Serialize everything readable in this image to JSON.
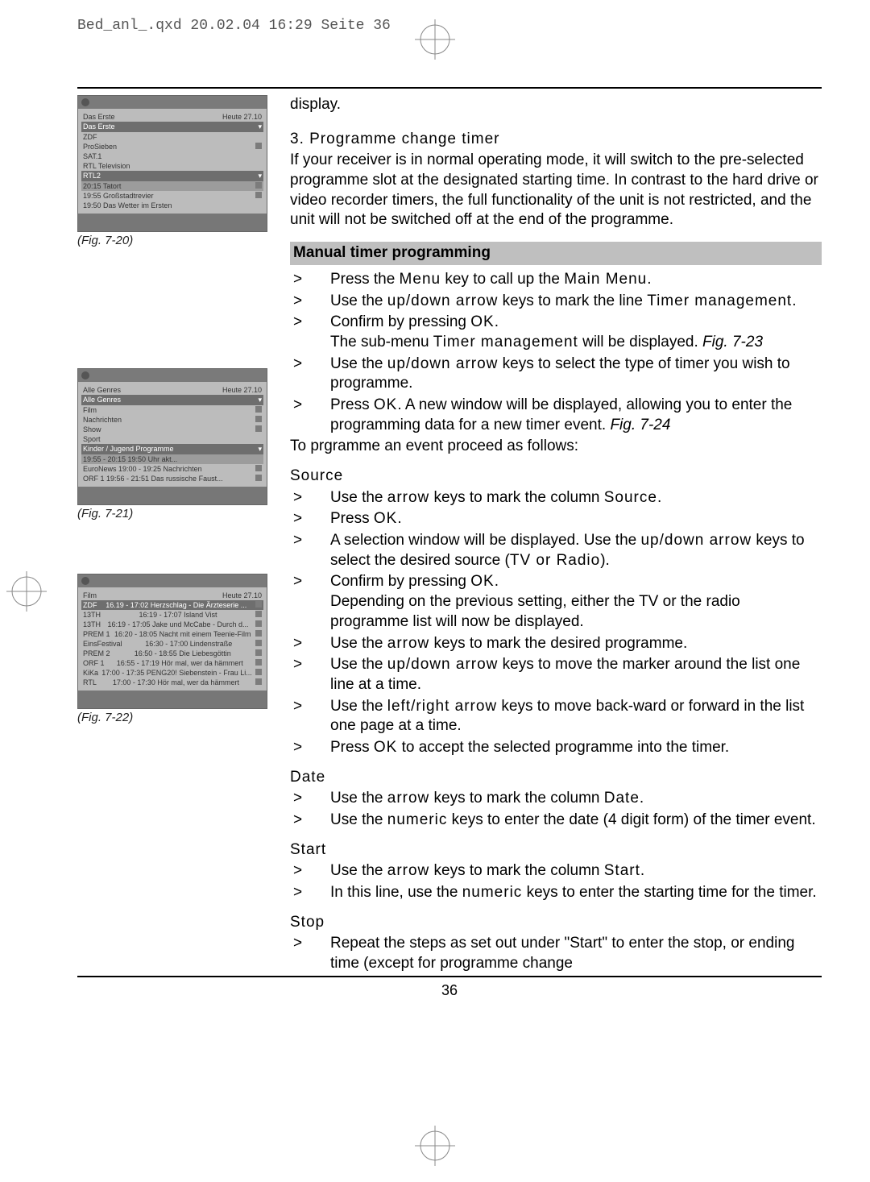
{
  "header": "Bed_anl_.qxd  20.02.04  16:29  Seite 36",
  "page_number": "36",
  "figures": {
    "f20": {
      "caption": "(Fig. 7-20)",
      "top_right": "Heute 27.10",
      "rows": [
        "Das Erste",
        "Das Erste",
        "ZDF",
        "ProSieben",
        "SAT.1",
        "RTL Television",
        "RTL2",
        "20:15 Tatort",
        "19:55 Großstadtrevier",
        "19:50 Das Wetter im Ersten"
      ]
    },
    "f21": {
      "caption": "(Fig. 7-21)",
      "top_right": "Heute 27.10",
      "rows": [
        "Alle Genres",
        "Alle Genres",
        "Film",
        "Nachrichten",
        "Show",
        "Sport",
        "Kinder / Jugend Programme",
        "19:55 - 20:15 19:50 Uhr akt...",
        "EuroNews   19:00 - 19:25 Nachrichten",
        "ORF 1   19:56 - 21:51 Das russische Faust..."
      ]
    },
    "f22": {
      "caption": "(Fig. 7-22)",
      "top_right": "Heute 27.10",
      "label": "Film",
      "rows": [
        {
          "ch": "ZDF",
          "t": "16.19 - 17:02 Herzschlag - Die Ärzteserie ..."
        },
        {
          "ch": "13TH",
          "t": "16:19 - 17:07 Island Vist"
        },
        {
          "ch": "13TH",
          "t": "16:19 - 17:05 Jake und McCabe - Durch d..."
        },
        {
          "ch": "PREM 1",
          "t": "16:20 - 18:05 Nacht mit einem Teenie-Film"
        },
        {
          "ch": "EinsFestival",
          "t": "16:30 - 17:00 Lindenstraße"
        },
        {
          "ch": "PREM 2",
          "t": "16:50 - 18:55 Die Liebesgöttin"
        },
        {
          "ch": "ORF 1",
          "t": "16:55 - 17:19 Hör mal, wer da hämmert"
        },
        {
          "ch": "KiKa",
          "t": "17:00 - 17:35 PENG20! Siebenstein - Frau Li..."
        },
        {
          "ch": "RTL",
          "t": "17:00 - 17:30 Hör mal, wer da hämmert"
        }
      ]
    }
  },
  "body": {
    "intro_cont": "display.",
    "sec3_title": "3. Programme change timer",
    "sec3_para": "If your receiver is in normal operating mode, it will switch to the pre-selected programme slot at the designated starting time. In contrast to the hard drive or video recorder timers, the full functionality of the unit is not restricted, and the unit will not be switched off at the end of the programme.",
    "manual_heading": "Manual timer programming",
    "steps_top": [
      "Press the <span class='ls'>Menu</span> key to call up the <span class='ls'>Main Menu</span>.",
      "Use the <span class='ls'>up/down arrow</span> keys to mark the line <span class='ls'>Timer management</span>.",
      "Confirm by pressing <span class='ls'>OK</span>.<br>The sub-menu <span class='ls'>Timer management</span> will be displayed. <span class='i'>Fig. 7-23</span>",
      "Use the <span class='ls'>up/down arrow</span> keys to select the type of timer you wish to programme.",
      "Press <span class='ls'>OK</span>. A new window will be displayed, allowing you to enter the programming data for a new timer event. <span class='i'>Fig. 7-24</span>"
    ],
    "to_programme": "To prgramme an event proceed as follows:",
    "source_label": "Source",
    "source_steps": [
      "Use the <span class='ls'>arrow</span> keys to mark the column <span class='ls'>Source</span>.",
      "Press <span class='ls'>OK</span>.",
      "A selection window will be displayed. Use the <span class='ls'>up/down arrow</span> keys to select the desired source (<span class='ls'>TV or Radio</span>).",
      "Confirm by pressing <span class='ls'>OK</span>.<br>Depending on the previous setting, either the TV or the radio programme list will now be displayed.",
      "Use the <span class='ls'>arrow</span> keys to mark the desired programme.",
      "Use the <span class='ls'>up/down arrow</span> keys to move the marker around the list one line at a time.",
      "Use the <span class='ls'>left/right arrow</span> keys to move back-ward or forward in the list one page at a time.",
      "Press <span class='ls'>OK</span> to accept the selected programme into the timer."
    ],
    "date_label": "Date",
    "date_steps": [
      "Use the <span class='ls'>arrow</span> keys to mark the column <span class='ls'>Date</span>.",
      "Use the <span class='ls'>numeric</span> keys to enter the date (4 digit form) of the timer event."
    ],
    "start_label": "Start",
    "start_steps": [
      "Use the <span class='ls'>arrow</span> keys to mark the column <span class='ls'>Start</span>.",
      "In this line, use the <span class='ls'>numeric</span> keys to enter the starting time for the timer."
    ],
    "stop_label": "Stop",
    "stop_steps": [
      "Repeat the steps as set out under \"Start\" to enter the stop, or ending time (except for programme change"
    ]
  }
}
